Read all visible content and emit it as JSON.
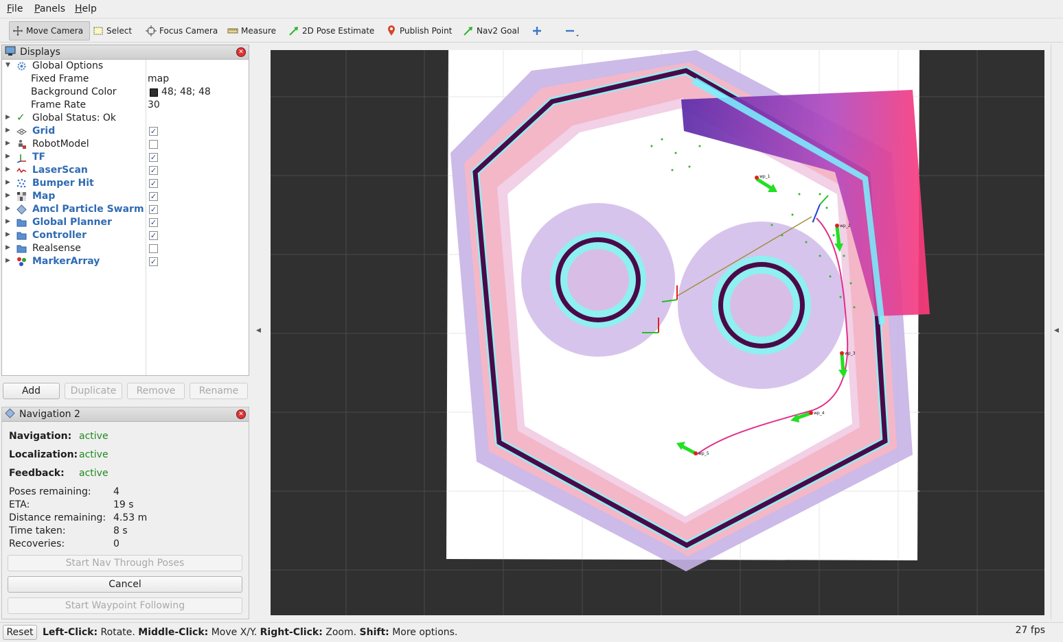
{
  "menubar": {
    "items": [
      {
        "label": "File",
        "mnemonic": "F",
        "rest": "ile"
      },
      {
        "label": "Panels",
        "mnemonic": "P",
        "rest": "anels"
      },
      {
        "label": "Help",
        "mnemonic": "H",
        "rest": "elp"
      }
    ]
  },
  "toolbar": {
    "move_camera": "Move Camera",
    "select": "Select",
    "focus_camera": "Focus Camera",
    "measure": "Measure",
    "pose_estimate": "2D Pose Estimate",
    "publish_point": "Publish Point",
    "nav2_goal": "Nav2 Goal"
  },
  "displays": {
    "title": "Displays",
    "global_options": "Global Options",
    "fixed_frame_label": "Fixed Frame",
    "fixed_frame_value": "map",
    "background_color_label": "Background Color",
    "background_color_value": "48; 48; 48",
    "background_color_swatch": "#303030",
    "frame_rate_label": "Frame Rate",
    "frame_rate_value": "30",
    "global_status": "Global Status: Ok",
    "items": [
      {
        "label": "Grid",
        "checked": true,
        "icon": "grid-icon"
      },
      {
        "label": "RobotModel",
        "checked": false,
        "icon": "robot-icon"
      },
      {
        "label": "TF",
        "checked": true,
        "icon": "tf-axes-icon"
      },
      {
        "label": "LaserScan",
        "checked": true,
        "icon": "laser-icon"
      },
      {
        "label": "Bumper Hit",
        "checked": true,
        "icon": "points-icon"
      },
      {
        "label": "Map",
        "checked": true,
        "icon": "map-icon"
      },
      {
        "label": "Amcl Particle Swarm",
        "checked": true,
        "icon": "diamond-icon"
      },
      {
        "label": "Global Planner",
        "checked": true,
        "icon": "folder-icon"
      },
      {
        "label": "Controller",
        "checked": true,
        "icon": "folder-icon"
      },
      {
        "label": "Realsense",
        "checked": false,
        "icon": "folder-icon"
      },
      {
        "label": "MarkerArray",
        "checked": true,
        "icon": "marker-icon"
      }
    ],
    "buttons": {
      "add": "Add",
      "duplicate": "Duplicate",
      "remove": "Remove",
      "rename": "Rename"
    }
  },
  "navigation": {
    "title": "Navigation 2",
    "navigation_label": "Navigation:",
    "navigation_value": "active",
    "localization_label": "Localization:",
    "localization_value": "active",
    "feedback_label": "Feedback:",
    "feedback_value": "active",
    "poses_label": "Poses remaining:",
    "poses_value": "4",
    "eta_label": "ETA:",
    "eta_value": "19 s",
    "distance_label": "Distance remaining:",
    "distance_value": "4.53 m",
    "time_label": "Time taken:",
    "time_value": "8 s",
    "recoveries_label": "Recoveries:",
    "recoveries_value": "0",
    "start_nav_btn": "Start Nav Through Poses",
    "cancel_btn": "Cancel",
    "start_waypoint_btn": "Start Waypoint Following"
  },
  "statusbar": {
    "reset": "Reset",
    "left_click_label": "Left-Click:",
    "left_click_value": "Rotate.",
    "middle_click_label": "Middle-Click:",
    "middle_click_value": "Move X/Y.",
    "right_click_label": "Right-Click:",
    "right_click_value": "Zoom.",
    "shift_label": "Shift:",
    "shift_value": "More options.",
    "fps": "27 fps"
  },
  "viewport": {
    "background": "#303030",
    "waypoint_labels": [
      "wp_1",
      "wp_2",
      "wp_3",
      "wp_4",
      "wp_5"
    ]
  }
}
